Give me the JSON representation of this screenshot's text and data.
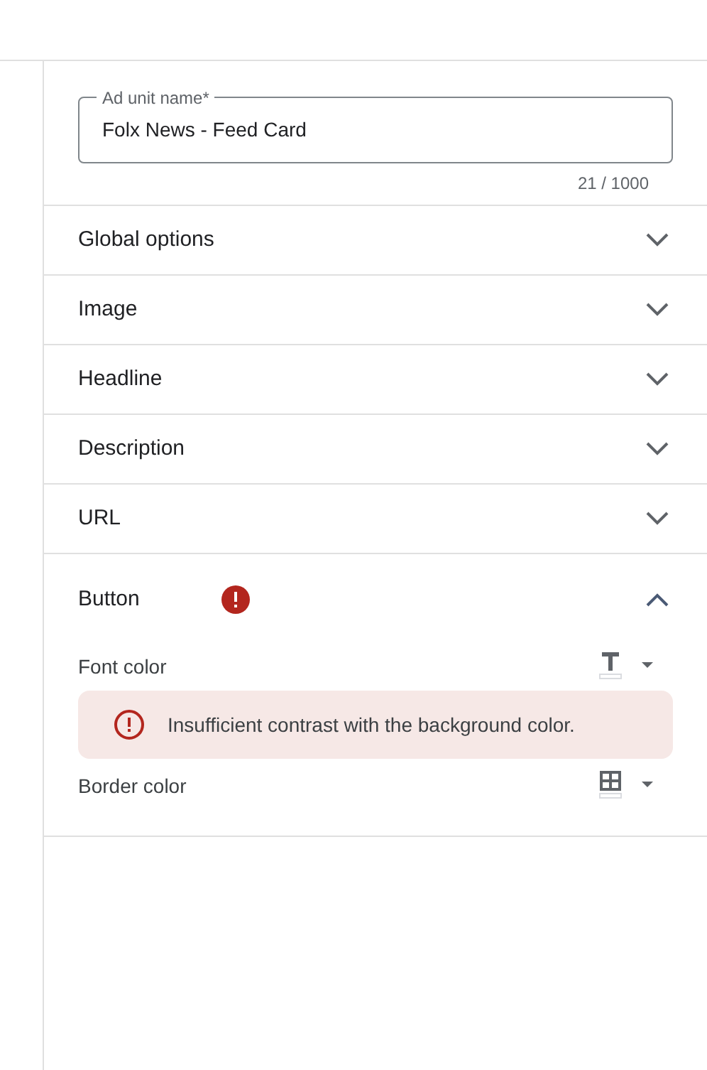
{
  "name_field": {
    "label": "Ad unit name*",
    "value": "Folx News - Feed Card",
    "counter": "21 / 1000"
  },
  "sections": [
    {
      "title": "Global options",
      "expanded": false,
      "error": false
    },
    {
      "title": "Image",
      "expanded": false,
      "error": false
    },
    {
      "title": "Headline",
      "expanded": false,
      "error": false
    },
    {
      "title": "Description",
      "expanded": false,
      "error": false
    },
    {
      "title": "URL",
      "expanded": false,
      "error": false
    },
    {
      "title": "Button",
      "expanded": true,
      "error": true,
      "options": [
        {
          "label": "Font color",
          "kind": "text",
          "warning": "Insufficient contrast with the background color."
        },
        {
          "label": "Border color",
          "kind": "border"
        }
      ]
    }
  ]
}
